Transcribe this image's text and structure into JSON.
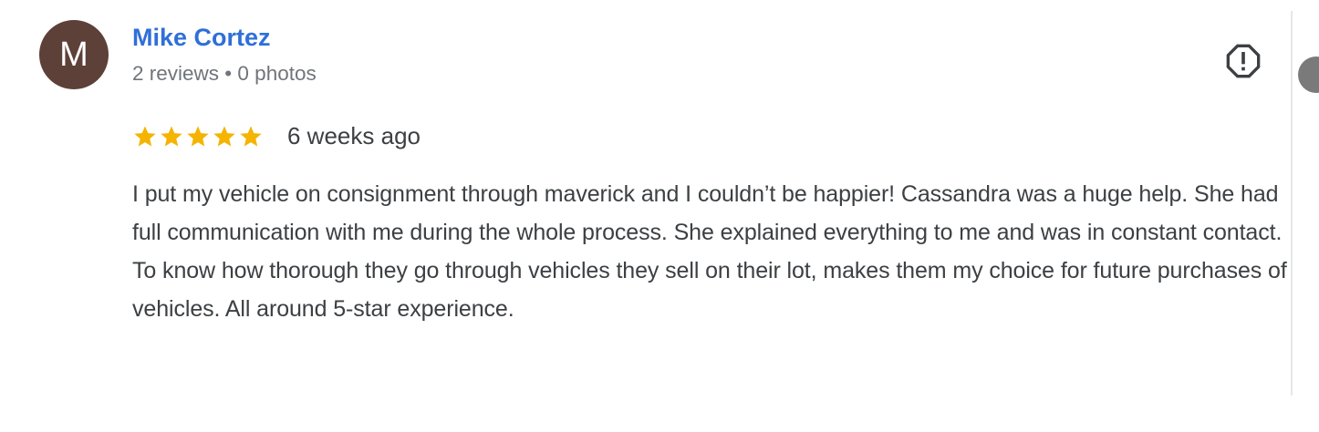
{
  "review": {
    "avatar_initial": "M",
    "author_name": "Mike Cortez",
    "author_meta": "2 reviews • 0 photos",
    "rating": 5,
    "rating_max": 5,
    "date": "6 weeks ago",
    "text": "I put my vehicle on consignment through maverick and I couldn’t be happier! Cassandra was a huge help. She had full communication with me during the whole process. She explained everything to me and was in constant contact. To know how thorough they go through vehicles they sell on their lot, makes them my choice for future purchases of vehicles. All around 5-star experience.",
    "flag_icon": "report-flag-icon"
  },
  "colors": {
    "avatar_bg": "#5d4037",
    "author_link": "#2f6fd8",
    "star": "#f4b400",
    "text": "#3c4043",
    "meta": "#70757a"
  }
}
